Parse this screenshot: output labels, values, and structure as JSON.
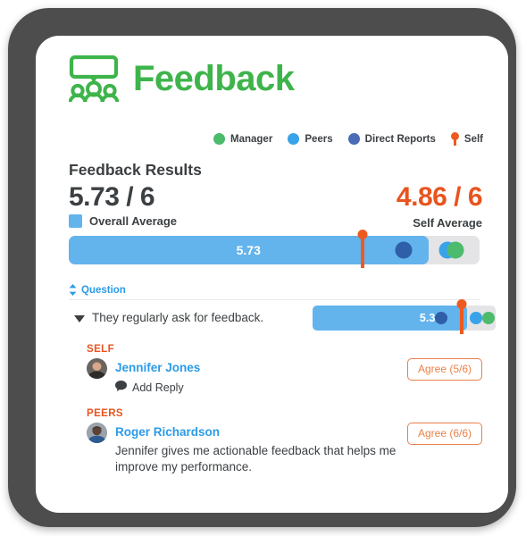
{
  "app": {
    "logo_icon": "feedback-group-speech-bubble-icon",
    "title": "Feedback",
    "brand_green": "#3EB44B",
    "accent_orange": "#E8541E",
    "accent_blue": "#2B9BE8",
    "bar_blue": "#63B3ED"
  },
  "legend": {
    "items": [
      {
        "label": "Manager",
        "color": "#4CBB6C",
        "marker": "dot"
      },
      {
        "label": "Peers",
        "color": "#38A3E8",
        "marker": "dot"
      },
      {
        "label": "Direct Reports",
        "color": "#4A6BB5",
        "marker": "dot"
      },
      {
        "label": "Self",
        "color": "#ED5A20",
        "marker": "pin"
      }
    ]
  },
  "results": {
    "title": "Feedback Results",
    "overall_score": "5.73 / 6",
    "overall_legend_label": "Overall Average",
    "self_score": "4.86 / 6",
    "self_label": "Self Average"
  },
  "main_bar": {
    "value_label": "5.73",
    "max": 6,
    "value": 5.73,
    "fill_percent": 87.5,
    "markers": [
      {
        "name": "self-pin",
        "type": "pin",
        "position_percent": 71.5,
        "color": "#ED5A20"
      },
      {
        "name": "direct-reports-dot",
        "type": "dot",
        "position_percent": 81.5,
        "color": "#2F5FA8",
        "size": 19
      },
      {
        "name": "peers-dot",
        "type": "dot",
        "position_percent": 92.2,
        "color": "#38A3E8",
        "size": 19
      },
      {
        "name": "manager-dot",
        "type": "dot",
        "position_percent": 94.2,
        "color": "#4CBB6C",
        "size": 19
      }
    ]
  },
  "question_header": {
    "sort_icon": "sort-updown-icon",
    "label": "Question"
  },
  "question": {
    "expand_icon": "caret-down-icon",
    "text": "They regularly ask for feedback.",
    "value_label": "5.36",
    "value": 5.36,
    "max": 6,
    "fill_percent": 84.5,
    "markers": [
      {
        "name": "direct-reports-dot",
        "type": "dot",
        "position_percent": 70.0,
        "color": "#2F5FA8",
        "size": 14
      },
      {
        "name": "self-pin",
        "type": "pin",
        "position_percent": 81.5,
        "color": "#ED5A20"
      },
      {
        "name": "peers-dot",
        "type": "dot",
        "position_percent": 89.5,
        "color": "#38A3E8",
        "size": 14
      },
      {
        "name": "manager-dot",
        "type": "dot",
        "position_percent": 96.0,
        "color": "#4CBB6C",
        "size": 14
      }
    ]
  },
  "responses": [
    {
      "group": "SELF",
      "avatar_icon": "avatar-jennifer-jones",
      "name": "Jennifer Jones",
      "badge": "Agree (5/6)",
      "reply_icon": "comment-bubble-icon",
      "reply_label": "Add Reply",
      "comment": ""
    },
    {
      "group": "PEERS",
      "avatar_icon": "avatar-roger-richardson",
      "name": "Roger Richardson",
      "badge": "Agree (6/6)",
      "reply_icon": "",
      "reply_label": "",
      "comment": "Jennifer gives me actionable feedback that helps me improve my performance."
    }
  ]
}
